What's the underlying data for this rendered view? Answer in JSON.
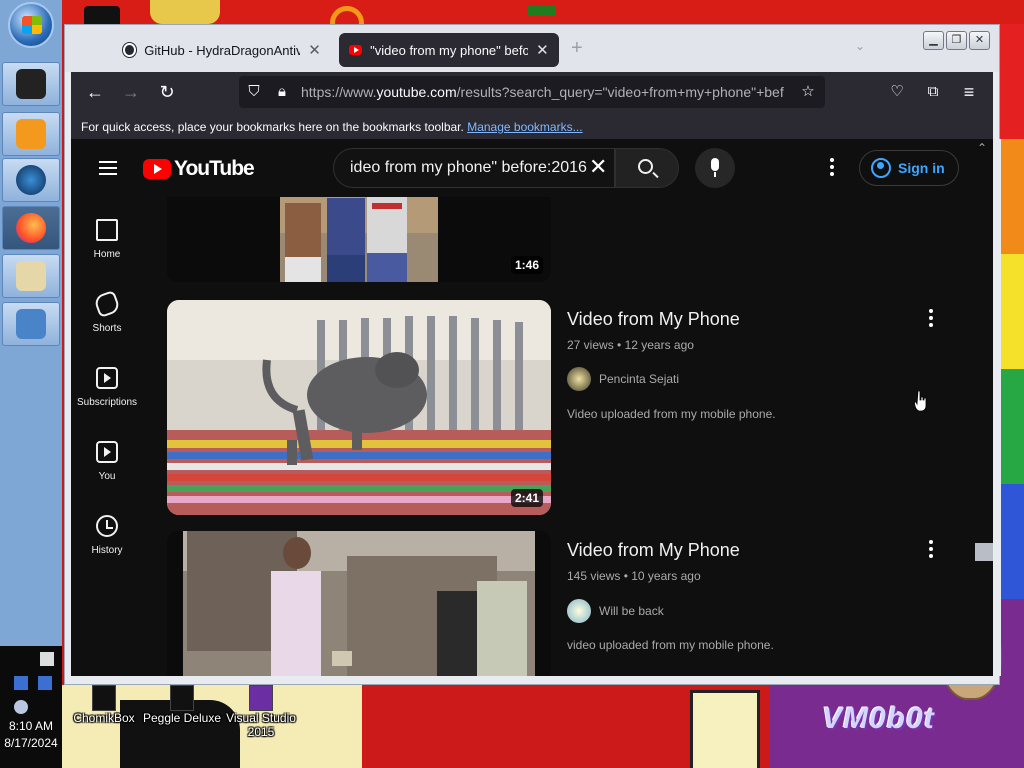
{
  "browser": {
    "tabs": [
      {
        "title": "GitHub - HydraDragonAntivirus",
        "active": false
      },
      {
        "title": "\"video from my phone\" before:",
        "active": true
      }
    ],
    "new_tab_label": "+",
    "url_prefix": "https://www.",
    "url_domain": "youtube.com",
    "url_rest": "/results?search_query=\"video+from+my+phone\"+bef",
    "bookmarks_message": "For quick access, place your bookmarks here on the bookmarks toolbar.",
    "bookmarks_link": "Manage bookmarks..."
  },
  "youtube": {
    "logo_text": "YouTube",
    "search_query": "ideo from my phone\" before:2016",
    "signin_label": "Sign in",
    "sidebar": [
      {
        "label": "Home",
        "icon": "home-icon"
      },
      {
        "label": "Shorts",
        "icon": "shorts-icon"
      },
      {
        "label": "Subscriptions",
        "icon": "subscriptions-icon"
      },
      {
        "label": "You",
        "icon": "you-icon"
      },
      {
        "label": "History",
        "icon": "history-icon"
      }
    ],
    "results": [
      {
        "duration": "1:46"
      },
      {
        "title": "Video from My Phone",
        "views": "27 views",
        "age": "12 years ago",
        "channel": "Pencinta Sejati",
        "description": "Video uploaded from my mobile phone.",
        "duration": "2:41"
      },
      {
        "title": "Video from My Phone",
        "views": "145 views",
        "age": "10 years ago",
        "channel": "Will be back",
        "description": "video uploaded from my mobile phone."
      }
    ]
  },
  "taskbar": {
    "time": "8:10 AM",
    "date": "8/17/2024"
  },
  "desktop": {
    "icons": [
      {
        "label": "ChomikBox"
      },
      {
        "label": "Peggle Deluxe"
      },
      {
        "label": "Visual Studio 2015"
      }
    ],
    "watermark": "VM0b0t"
  },
  "colors": {
    "youtube_red": "#ff0000",
    "link_blue": "#3ea6ff",
    "page_bg": "#0f0f0f"
  }
}
